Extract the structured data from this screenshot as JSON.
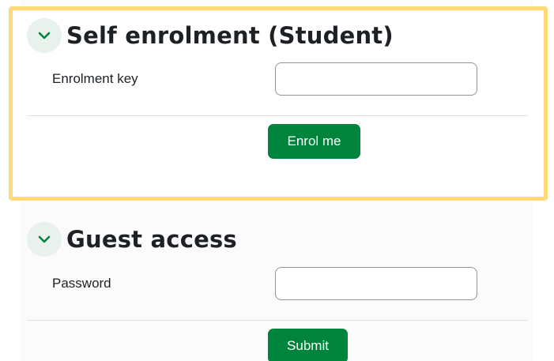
{
  "self_enrolment": {
    "title": "Self enrolment (Student)",
    "toggle_icon": "chevron-down-icon",
    "field_label": "Enrolment key",
    "field_value": "",
    "field_placeholder": "",
    "button_label": "Enrol me",
    "highlighted": true,
    "highlight_color": "#ffd97a"
  },
  "guest_access": {
    "title": "Guest access",
    "toggle_icon": "chevron-down-icon",
    "field_label": "Password",
    "field_value": "",
    "field_placeholder": "",
    "button_label": "Submit"
  },
  "colors": {
    "primary_button": "#00843c",
    "toggle_background": "#e8f1ec",
    "toggle_icon": "#00843c",
    "text": "#1d2125"
  }
}
